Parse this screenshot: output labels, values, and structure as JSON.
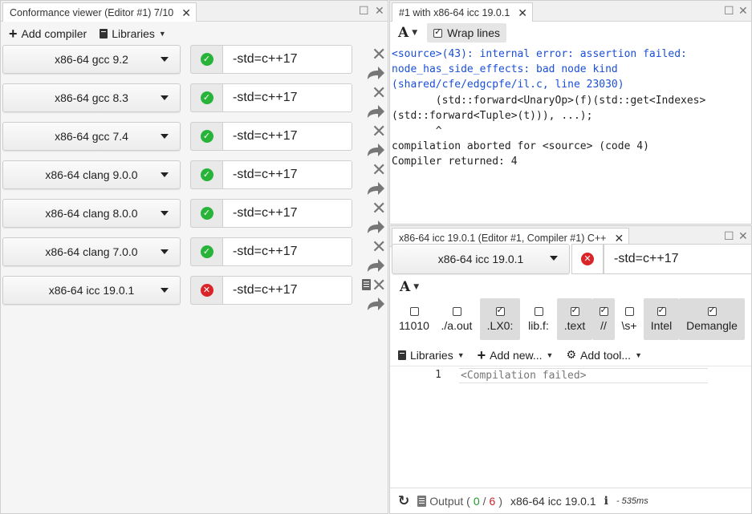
{
  "left_panel": {
    "tab_title": "Conformance viewer (Editor #1) 7/10",
    "add_compiler_label": "Add compiler",
    "libraries_label": "Libraries",
    "compilers": [
      {
        "name": "x86-64 gcc 9.2",
        "options": "-std=c++17",
        "status": "ok"
      },
      {
        "name": "x86-64 gcc 8.3",
        "options": "-std=c++17",
        "status": "ok"
      },
      {
        "name": "x86-64 gcc 7.4",
        "options": "-std=c++17",
        "status": "ok"
      },
      {
        "name": "x86-64 clang 9.0.0",
        "options": "-std=c++17",
        "status": "ok"
      },
      {
        "name": "x86-64 clang 8.0.0",
        "options": "-std=c++17",
        "status": "ok"
      },
      {
        "name": "x86-64 clang 7.0.0",
        "options": "-std=c++17",
        "status": "ok"
      },
      {
        "name": "x86-64 icc 19.0.1",
        "options": "-std=c++17",
        "status": "error"
      }
    ]
  },
  "output_panel": {
    "tab_title": "#1 with x86-64 icc 19.0.1",
    "font_label": "A",
    "wrap_label": "Wrap lines",
    "error_lines": [
      "<source>(43): internal error: assertion failed:",
      "node_has_side_effects: bad node kind",
      "(shared/cfe/edgcpfe/il.c, line 23030)"
    ],
    "code_lines": [
      "",
      "       (std::forward<UnaryOp>(f)(std::get<Indexes>",
      "(std::forward<Tuple>(t))), ...);",
      "       ^",
      "",
      "compilation aborted for <source> (code 4)",
      "Compiler returned: 4"
    ]
  },
  "compiler_panel": {
    "tab_title": "x86-64 icc 19.0.1 (Editor #1, Compiler #1) C++",
    "compiler_name": "x86-64 icc 19.0.1",
    "options": "-std=c++17",
    "font_label": "A",
    "filters": [
      {
        "label": "11010",
        "checked": false
      },
      {
        "label": "./a.out",
        "checked": false
      },
      {
        "label": ".LX0:",
        "checked": true
      },
      {
        "label": "lib.f:",
        "checked": false
      },
      {
        "label": ".text",
        "checked": true
      },
      {
        "label": "//",
        "checked": true
      },
      {
        "label": "\\s+",
        "checked": false
      },
      {
        "label": "Intel",
        "checked": true
      },
      {
        "label": "Demangle",
        "checked": true
      }
    ],
    "libraries_label": "Libraries",
    "add_new_label": "Add new...",
    "add_tool_label": "Add tool...",
    "line_number": "1",
    "asm_line": "<Compilation failed>",
    "status": {
      "output_label": "Output (",
      "ok_count": "0",
      "separator": "/",
      "err_count": "6",
      "close_paren": ")",
      "compiler": "x86-64 icc 19.0.1",
      "info_icon": "i",
      "time": "- 535ms"
    }
  },
  "colors": {
    "ok": "#28b43a",
    "error": "#d9242a",
    "link_blue": "#1a4fd6"
  }
}
